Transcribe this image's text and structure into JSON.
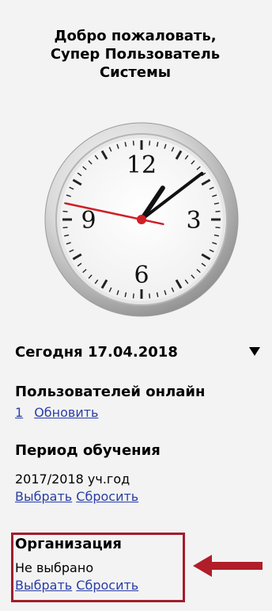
{
  "welcome": {
    "line1": "Добро пожаловать,",
    "line2": "Супер Пользователь",
    "line3": "Системы"
  },
  "clock": {
    "numerals": [
      "12",
      "3",
      "6",
      "9"
    ],
    "time": "13:08:47",
    "hand_color": "#cf1f26"
  },
  "today": {
    "label": "Сегодня 17.04.2018",
    "toggle_icon": "triangle-down-icon"
  },
  "online": {
    "title": "Пользователей онлайн",
    "count": "1",
    "refresh_label": "Обновить"
  },
  "period": {
    "title": "Период обучения",
    "value": "2017/2018 уч.год",
    "select_label": "Выбрать",
    "reset_label": "Сбросить"
  },
  "organization": {
    "title": "Организация",
    "value": "Не выбрано",
    "select_label": "Выбрать",
    "reset_label": "Сбросить",
    "highlight_color": "#a11e2a"
  }
}
